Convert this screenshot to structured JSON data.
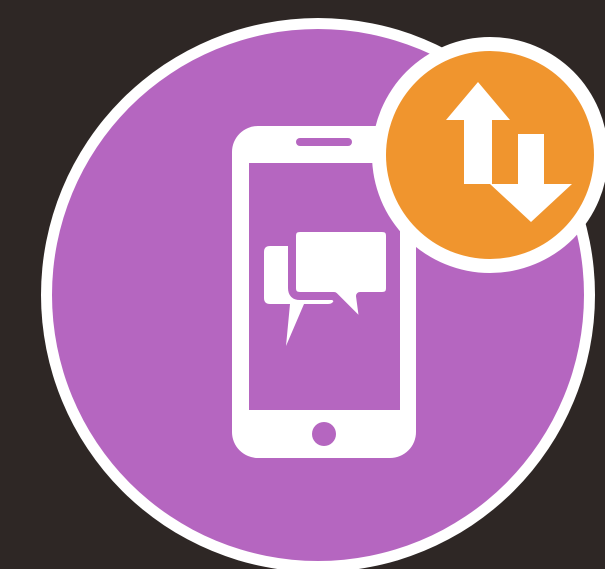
{
  "colors": {
    "background": "#2e2725",
    "main_circle": "#b566c0",
    "screen": "#b566c0",
    "badge": "#f0952e",
    "outline": "#ffffff"
  },
  "icons": {
    "main": "mobile-messaging-icon",
    "phone": "smartphone-icon",
    "chat": "chat-bubbles-icon",
    "sync": "up-down-arrows-icon"
  }
}
